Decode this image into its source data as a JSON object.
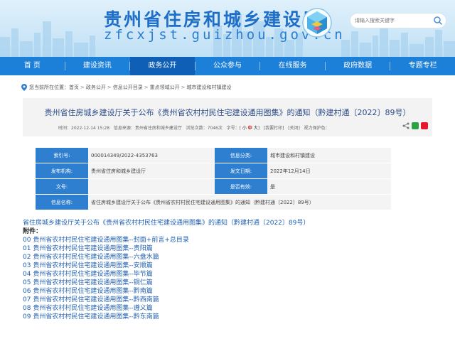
{
  "header": {
    "title": "贵州省住房和城乡建设厅",
    "url": "zfcxjst.guizhou.gov.cn",
    "search_placeholder": "请输入搜索关键字"
  },
  "nav": [
    "首 页",
    "建设资讯",
    "政务公开",
    "公众参与",
    "在线服务",
    "政府数据",
    "专题专栏"
  ],
  "breadcrumb": {
    "prefix": "您当前所在位置：",
    "items": [
      "首页",
      "政务公开",
      "信息公开目录",
      "重点领域公开",
      "城市建设和村镇建设"
    ]
  },
  "article": {
    "title": "贵州省住房城乡建设厅关于公布《贵州省农村村民住宅建设通用图集》的通知（黔建村通〔2022〕89号）",
    "date": "时间：2022-12-14 15:28",
    "source": "信息来源：贵州省住房和城乡建设厅",
    "views": "浏览次数：7046次",
    "size_label": "字号：",
    "size_small": "小",
    "size_mid": "中",
    "size_large": "大",
    "print": "[我要打印]",
    "close": "[关闭]",
    "vision": "视力保护色："
  },
  "info": {
    "index_label": "索引号:",
    "index_value": "000014349/2022-4353763",
    "category_label": "信息分类:",
    "category_value": "城市建设和村镇建设",
    "org_label": "发布机构:",
    "org_value": "贵州省住房和城乡建设厅",
    "date_label": "发文日期:",
    "date_value": "2022年12月14日",
    "doc_label": "文号:",
    "doc_value": "",
    "valid_label": "是否有效:",
    "valid_value": "是",
    "name_label": "信息名称:",
    "name_value": "省住房城乡建设厅关于公布《贵州省农村村民住宅建设通用图集》的通知（黔建村通〔2022〕89号）"
  },
  "body": {
    "lead": "省住房城乡建设厅关于公布《贵州省农村村民住宅建设通用图集》的通知（黔建村通〔2022〕89号）",
    "attachments_label": "附件：",
    "attachments": [
      "00 贵州省农村村民住宅建设通用图集--封面+前言+总目录",
      "01 贵州省农村村民住宅建设通用图集--贵阳篇",
      "02 贵州省农村村民住宅建设通用图集--六盘水篇",
      "03 贵州省农村村民住宅建设通用图集--安顺篇",
      "04 贵州省农村村民住宅建设通用图集--毕节篇",
      "05 贵州省农村村民住宅建设通用图集--铜仁篇",
      "06 贵州省农村村民住宅建设通用图集--黔南篇",
      "07 贵州省农村村民住宅建设通用图集--黔西南篇",
      "08 贵州省农村村民住宅建设通用图集--遵义篇",
      "09 贵州省农村村民住宅建设通用图集--黔东南篇"
    ]
  },
  "colors": {
    "nav_bg": "#1c7fd8",
    "nav_active": "#0f5fb6",
    "title_blue": "#1f6fc9",
    "label_bg": "#2f7fd0",
    "link_blue": "#1f5fb0"
  }
}
